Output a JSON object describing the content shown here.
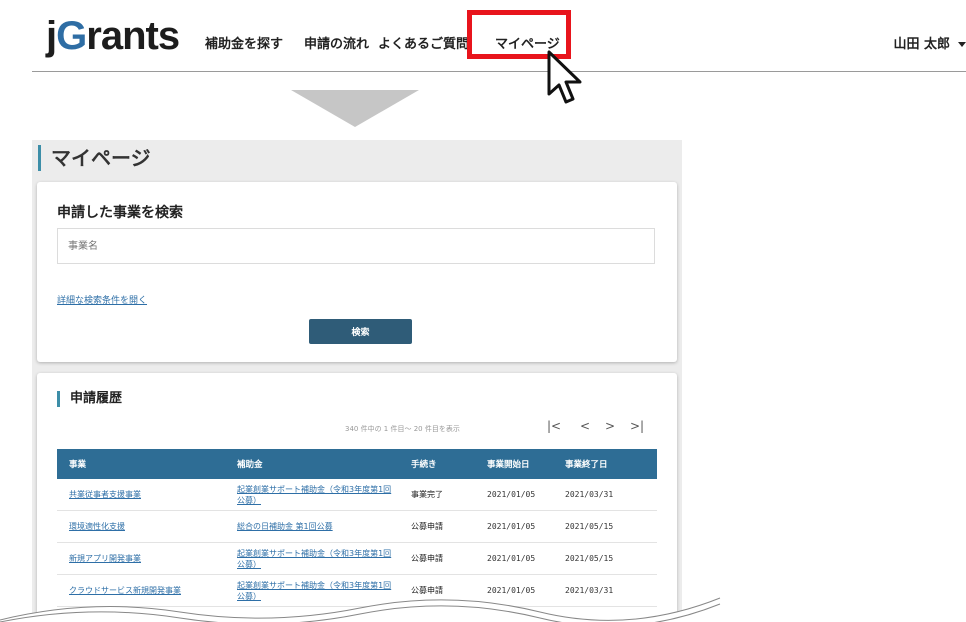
{
  "app": {
    "logo_j": "j",
    "logo_g": "G",
    "logo_rest": "rants"
  },
  "nav": {
    "items": [
      "補助金を探す",
      "申請の流れ",
      "よくあるご質問",
      "マイページ"
    ],
    "user_name": "山田 太郎"
  },
  "page": {
    "title": "マイページ"
  },
  "search": {
    "title": "申請した事業を検索",
    "placeholder": "事業名",
    "advanced_link": "詳細な検索条件を開く",
    "button": "検索"
  },
  "history": {
    "title": "申請履歴",
    "pager_text": "340 件中の 1 件目～ 20 件目を表示",
    "pager_first": "|<",
    "pager_prev": "<",
    "pager_next": ">",
    "pager_last": ">|",
    "columns": [
      "事業",
      "補助金",
      "手続き",
      "事業開始日",
      "事業終了日"
    ],
    "rows": [
      [
        "共業従事者支援事業",
        "起業創業サポート補助金（令和3年度第1回公募）",
        "事業完了",
        "2021/01/05",
        "2021/03/31"
      ],
      [
        "環境適性化支援",
        "総合の日補助金 第1回公募",
        "公募申請",
        "2021/01/05",
        "2021/05/15"
      ],
      [
        "新規アプリ開発事業",
        "起業創業サポート補助金（令和3年度第1回公募）",
        "公募申請",
        "2021/01/05",
        "2021/05/15"
      ],
      [
        "クラウドサービス新規開発事業",
        "起業創業サポート補助金（令和3年度第1回公募）",
        "公募申請",
        "2021/01/05",
        "2021/03/31"
      ]
    ]
  },
  "colors": {
    "accent": "#2e6d95",
    "highlight": "#e8141c",
    "button": "#2f5c78",
    "link": "#2e6fa7"
  }
}
